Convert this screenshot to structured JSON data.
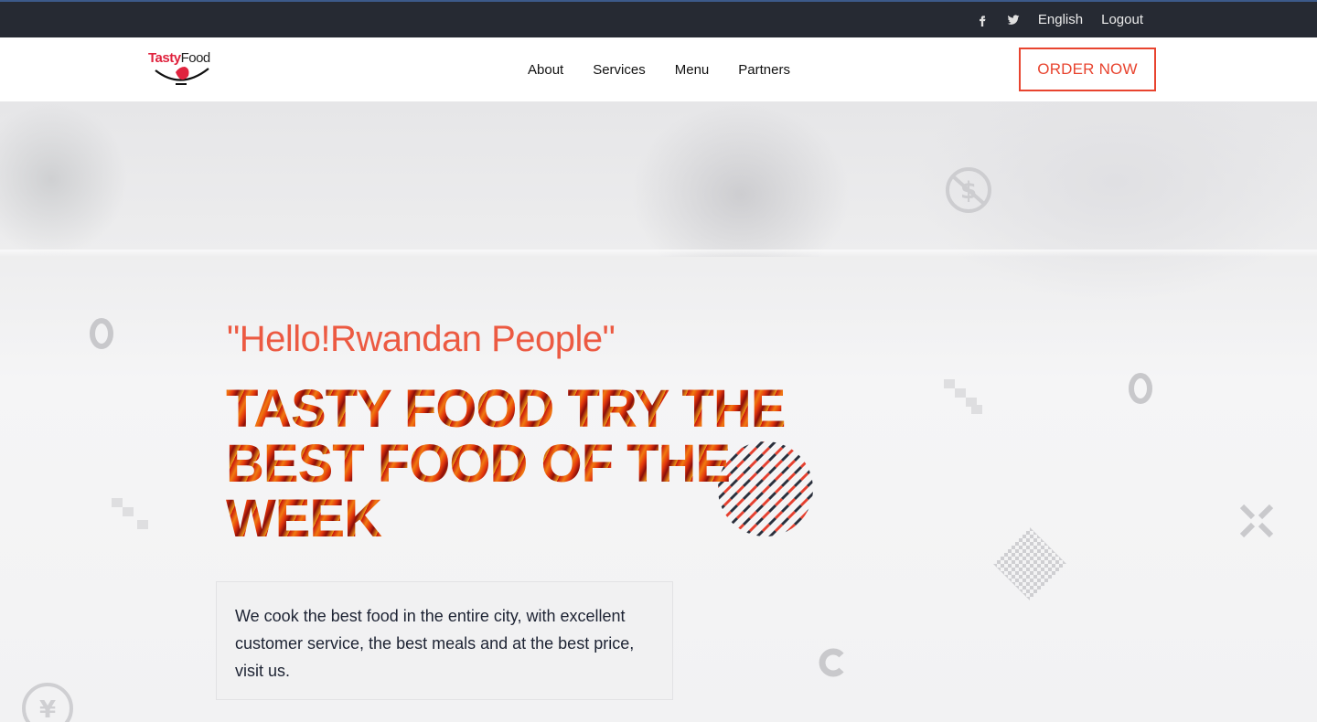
{
  "topbar": {
    "icons": [
      "facebook-icon",
      "twitter-icon"
    ],
    "language_label": "English",
    "logout_label": "Logout"
  },
  "header": {
    "logo": {
      "part1": "Tasty",
      "part2": "Food"
    },
    "nav": [
      {
        "label": "About"
      },
      {
        "label": "Services"
      },
      {
        "label": "Menu"
      },
      {
        "label": "Partners"
      }
    ],
    "order_button": "ORDER NOW"
  },
  "hero": {
    "subtitle": "\"Hello!Rwandan People\"",
    "headline": "TASTY FOOD TRY THE BEST FOOD OF THE WEEK",
    "description": "We cook the best food in the entire city, with excellent customer service, the best meals and at the best price, visit us."
  },
  "colors": {
    "accent": "#e8442f",
    "topbar": "#262a33",
    "brand_red": "#e0233e",
    "text_dark": "#1d2333"
  }
}
